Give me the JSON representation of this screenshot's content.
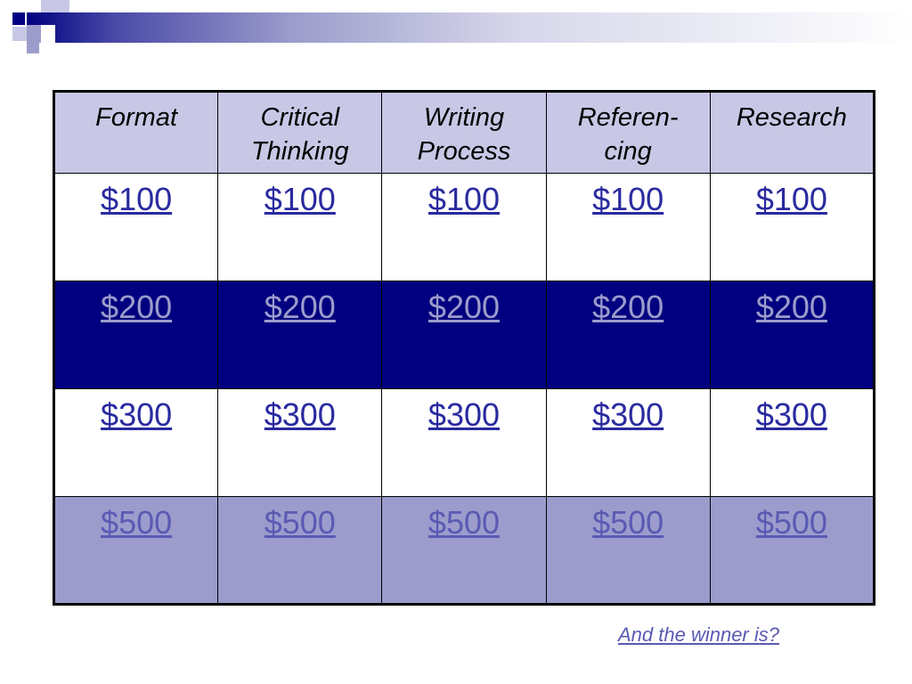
{
  "colors": {
    "navy": "#000080",
    "lavender_header": "#c8c8e6",
    "periwinkle_row": "#9c9ccc",
    "link_blue": "#2a2aa0"
  },
  "board": {
    "categories": [
      "Format",
      "Critical Thinking",
      "Writing Process",
      "Referen-cing",
      "Research"
    ],
    "category_lines": [
      [
        "Format"
      ],
      [
        "Critical",
        "Thinking"
      ],
      [
        "Writing",
        "Process"
      ],
      [
        "Referen-",
        "cing"
      ],
      [
        "Research"
      ]
    ],
    "rows": [
      {
        "value": "$100",
        "cells": [
          "$100",
          "$100",
          "$100",
          "$100",
          "$100"
        ]
      },
      {
        "value": "$200",
        "cells": [
          "$200",
          "$200",
          "$200",
          "$200",
          "$200"
        ]
      },
      {
        "value": "$300",
        "cells": [
          "$300",
          "$300",
          "$300",
          "$300",
          "$300"
        ]
      },
      {
        "value": "$500",
        "cells": [
          "$500",
          "$500",
          "$500",
          "$500",
          "$500"
        ]
      }
    ]
  },
  "footer": {
    "winner_link": "And the winner is?"
  }
}
